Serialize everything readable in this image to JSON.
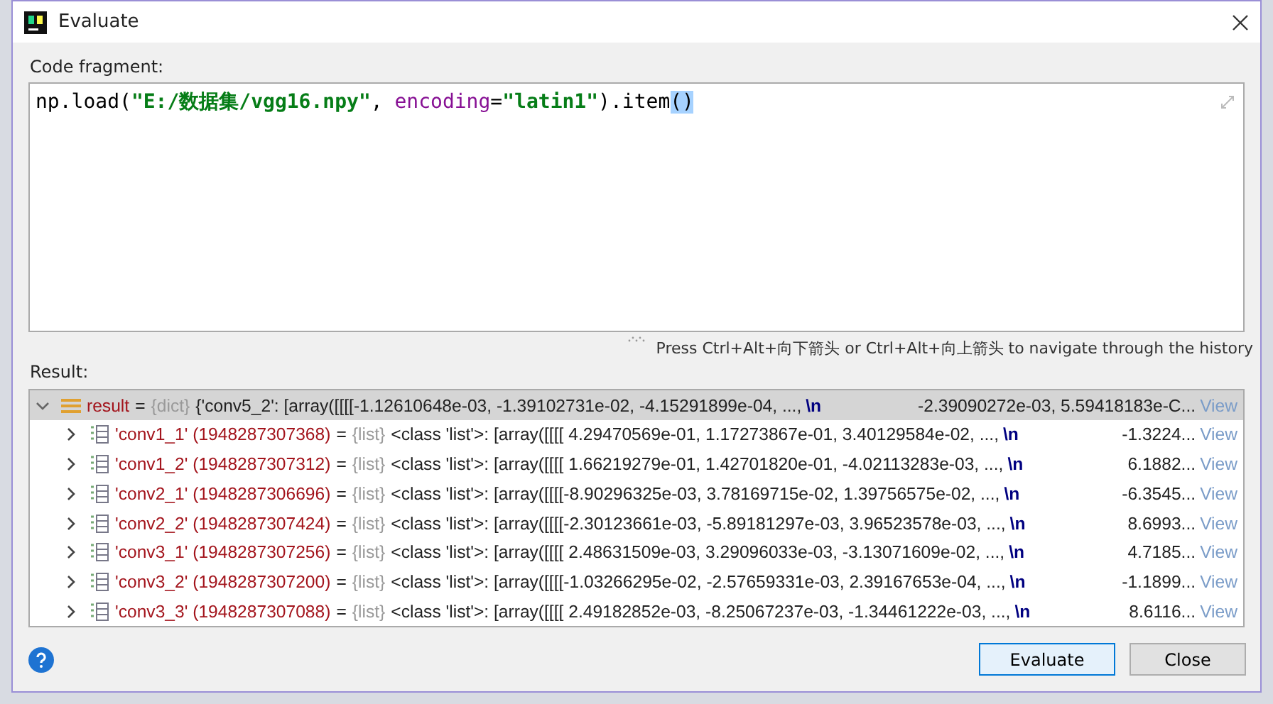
{
  "window": {
    "title": "Evaluate"
  },
  "code_fragment": {
    "label": "Code fragment:",
    "tokens": [
      {
        "kind": "plain",
        "text": "np.load("
      },
      {
        "kind": "string",
        "text": "\"E:/数据集/vgg16.npy\""
      },
      {
        "kind": "plain",
        "text": ", "
      },
      {
        "kind": "keyword",
        "text": "encoding"
      },
      {
        "kind": "plain",
        "text": "="
      },
      {
        "kind": "string",
        "text": "\"latin1\""
      },
      {
        "kind": "plain",
        "text": ").item"
      },
      {
        "kind": "highlight",
        "text": "()"
      }
    ]
  },
  "history_hint": "Press Ctrl+Alt+向下箭头 or Ctrl+Alt+向上箭头 to navigate through the history",
  "result": {
    "label": "Result:",
    "rows": [
      {
        "kind": "dict",
        "name": "result",
        "separator": "=",
        "type": "{dict}",
        "value": "{'conv5_2': [array([[[[-1.12610648e-03, -1.39102731e-02, -4.15291899e-04, ...,",
        "newline": "\\n",
        "tail": "-2.39090272e-03,  5.59418183e-C...",
        "link": "View",
        "expanded": true,
        "selected": true
      },
      {
        "kind": "list",
        "name": "'conv1_1' (1948287307368)",
        "separator": "=",
        "type": "{list}",
        "value": "<class 'list'>: [array([[[[ 4.29470569e-01,  1.17273867e-01,  3.40129584e-02, ...,",
        "newline": "\\n",
        "tail": "-1.3224...",
        "link": "View",
        "expanded": false,
        "selected": false
      },
      {
        "kind": "list",
        "name": "'conv1_2' (1948287307312)",
        "separator": "=",
        "type": "{list}",
        "value": "<class 'list'>: [array([[[[ 1.66219279e-01,  1.42701820e-01, -4.02113283e-03, ...,",
        "newline": "\\n",
        "tail": "6.1882...",
        "link": "View",
        "expanded": false,
        "selected": false
      },
      {
        "kind": "list",
        "name": "'conv2_1' (1948287306696)",
        "separator": "=",
        "type": "{list}",
        "value": "<class 'list'>: [array([[[[-8.90296325e-03,  3.78169715e-02,  1.39756575e-02, ...,",
        "newline": "\\n",
        "tail": "-6.3545...",
        "link": "View",
        "expanded": false,
        "selected": false
      },
      {
        "kind": "list",
        "name": "'conv2_2' (1948287307424)",
        "separator": "=",
        "type": "{list}",
        "value": "<class 'list'>: [array([[[[-2.30123661e-03, -5.89181297e-03,  3.96523578e-03, ...,",
        "newline": "\\n",
        "tail": "8.6993...",
        "link": "View",
        "expanded": false,
        "selected": false
      },
      {
        "kind": "list",
        "name": "'conv3_1' (1948287307256)",
        "separator": "=",
        "type": "{list}",
        "value": "<class 'list'>: [array([[[[ 2.48631509e-03,  3.29096033e-03, -3.13071609e-02, ...,",
        "newline": "\\n",
        "tail": "4.7185...",
        "link": "View",
        "expanded": false,
        "selected": false
      },
      {
        "kind": "list",
        "name": "'conv3_2' (1948287307200)",
        "separator": "=",
        "type": "{list}",
        "value": "<class 'list'>: [array([[[[-1.03266295e-02, -2.57659331e-03,  2.39167653e-04, ...,",
        "newline": "\\n",
        "tail": "-1.1899...",
        "link": "View",
        "expanded": false,
        "selected": false
      },
      {
        "kind": "list",
        "name": "'conv3_3' (1948287307088)",
        "separator": "=",
        "type": "{list}",
        "value": "<class 'list'>: [array([[[[ 2.49182852e-03, -8.25067237e-03, -1.34461222e-03, ...,",
        "newline": "\\n",
        "tail": "8.6116...",
        "link": "View",
        "expanded": false,
        "selected": false
      }
    ]
  },
  "buttons": [
    {
      "label": "Evaluate",
      "default": true
    },
    {
      "label": "Close",
      "default": false
    }
  ]
}
